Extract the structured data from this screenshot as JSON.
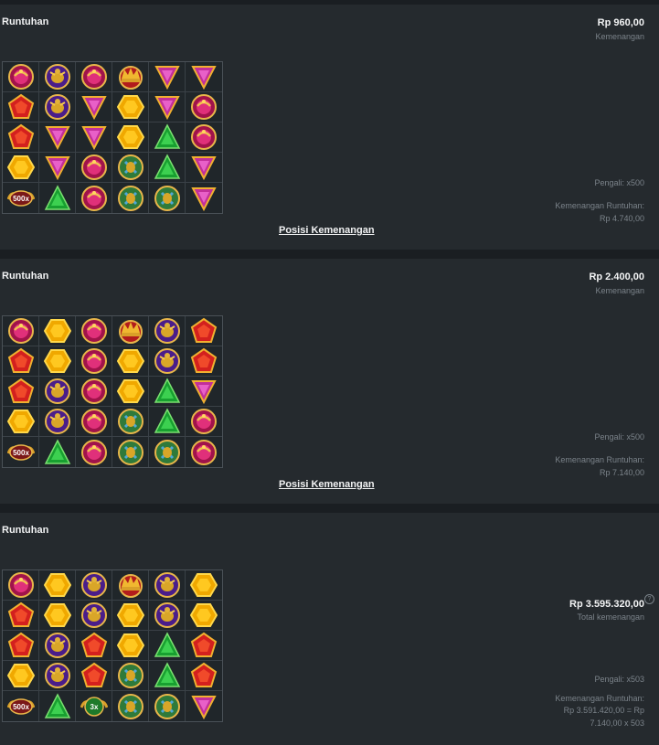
{
  "panels": [
    {
      "title": "Runtuhan",
      "amount": "Rp 960,00",
      "amount_label": "Kemenangan",
      "multiplier": "Pengali: x500",
      "cascade_label": "Kemenangan Runtuhan:",
      "cascade_value": "Rp 4.740,00",
      "link": "Posisi Kemenangan",
      "grid": [
        [
          "pink-ring",
          "purple-scarab",
          "pink-ring",
          "crown",
          "pink-triangle",
          "pink-triangle"
        ],
        [
          "red-pentagon",
          "purple-scarab",
          "pink-triangle",
          "yellow-hexagon",
          "pink-triangle",
          "pink-ring"
        ],
        [
          "red-pentagon",
          "pink-triangle",
          "pink-triangle",
          "yellow-hexagon",
          "green-triangle",
          "pink-ring"
        ],
        [
          "yellow-hexagon",
          "pink-triangle",
          "pink-ring",
          "green-scarab",
          "green-triangle",
          "pink-triangle"
        ],
        [
          "multiplier-500x",
          "green-triangle",
          "pink-ring",
          "green-scarab",
          "green-scarab",
          "pink-triangle"
        ]
      ]
    },
    {
      "title": "Runtuhan",
      "amount": "Rp 2.400,00",
      "amount_label": "Kemenangan",
      "multiplier": "Pengali: x500",
      "cascade_label": "Kemenangan Runtuhan:",
      "cascade_value": "Rp 7.140,00",
      "link": "Posisi Kemenangan",
      "grid": [
        [
          "pink-ring",
          "yellow-hexagon",
          "pink-ring",
          "crown",
          "purple-scarab",
          "red-pentagon"
        ],
        [
          "red-pentagon",
          "yellow-hexagon",
          "pink-ring",
          "yellow-hexagon",
          "purple-scarab",
          "red-pentagon"
        ],
        [
          "red-pentagon",
          "purple-scarab",
          "pink-ring",
          "yellow-hexagon",
          "green-triangle",
          "pink-triangle"
        ],
        [
          "yellow-hexagon",
          "purple-scarab",
          "pink-ring",
          "green-scarab",
          "green-triangle",
          "pink-ring"
        ],
        [
          "multiplier-500x",
          "green-triangle",
          "pink-ring",
          "green-scarab",
          "green-scarab",
          "pink-ring"
        ]
      ]
    },
    {
      "title": "Runtuhan",
      "amount": "Rp 3.595.320,00",
      "amount_label": "Total kemenangan",
      "help": "?",
      "multiplier": "Pengali: x503",
      "cascade_label": "Kemenangan Runtuhan:",
      "cascade_value": "Rp 3.591.420,00 = Rp",
      "cascade_value2": "7.140,00 x 503",
      "grid": [
        [
          "pink-ring",
          "yellow-hexagon",
          "purple-scarab",
          "crown",
          "purple-scarab",
          "yellow-hexagon"
        ],
        [
          "red-pentagon",
          "yellow-hexagon",
          "purple-scarab",
          "yellow-hexagon",
          "purple-scarab",
          "yellow-hexagon"
        ],
        [
          "red-pentagon",
          "purple-scarab",
          "red-pentagon",
          "yellow-hexagon",
          "green-triangle",
          "red-pentagon"
        ],
        [
          "yellow-hexagon",
          "purple-scarab",
          "red-pentagon",
          "green-scarab",
          "green-triangle",
          "red-pentagon"
        ],
        [
          "multiplier-500x",
          "green-triangle",
          "multiplier-3x",
          "green-scarab",
          "green-scarab",
          "pink-triangle"
        ]
      ]
    }
  ],
  "badges": {
    "multiplier-500x": "500x",
    "multiplier-3x": "3x"
  },
  "colors": {
    "panel_bg": "#252a2e",
    "page_bg": "#1a1e22",
    "muted_text": "#7b838a",
    "gold": "#e0b030"
  }
}
